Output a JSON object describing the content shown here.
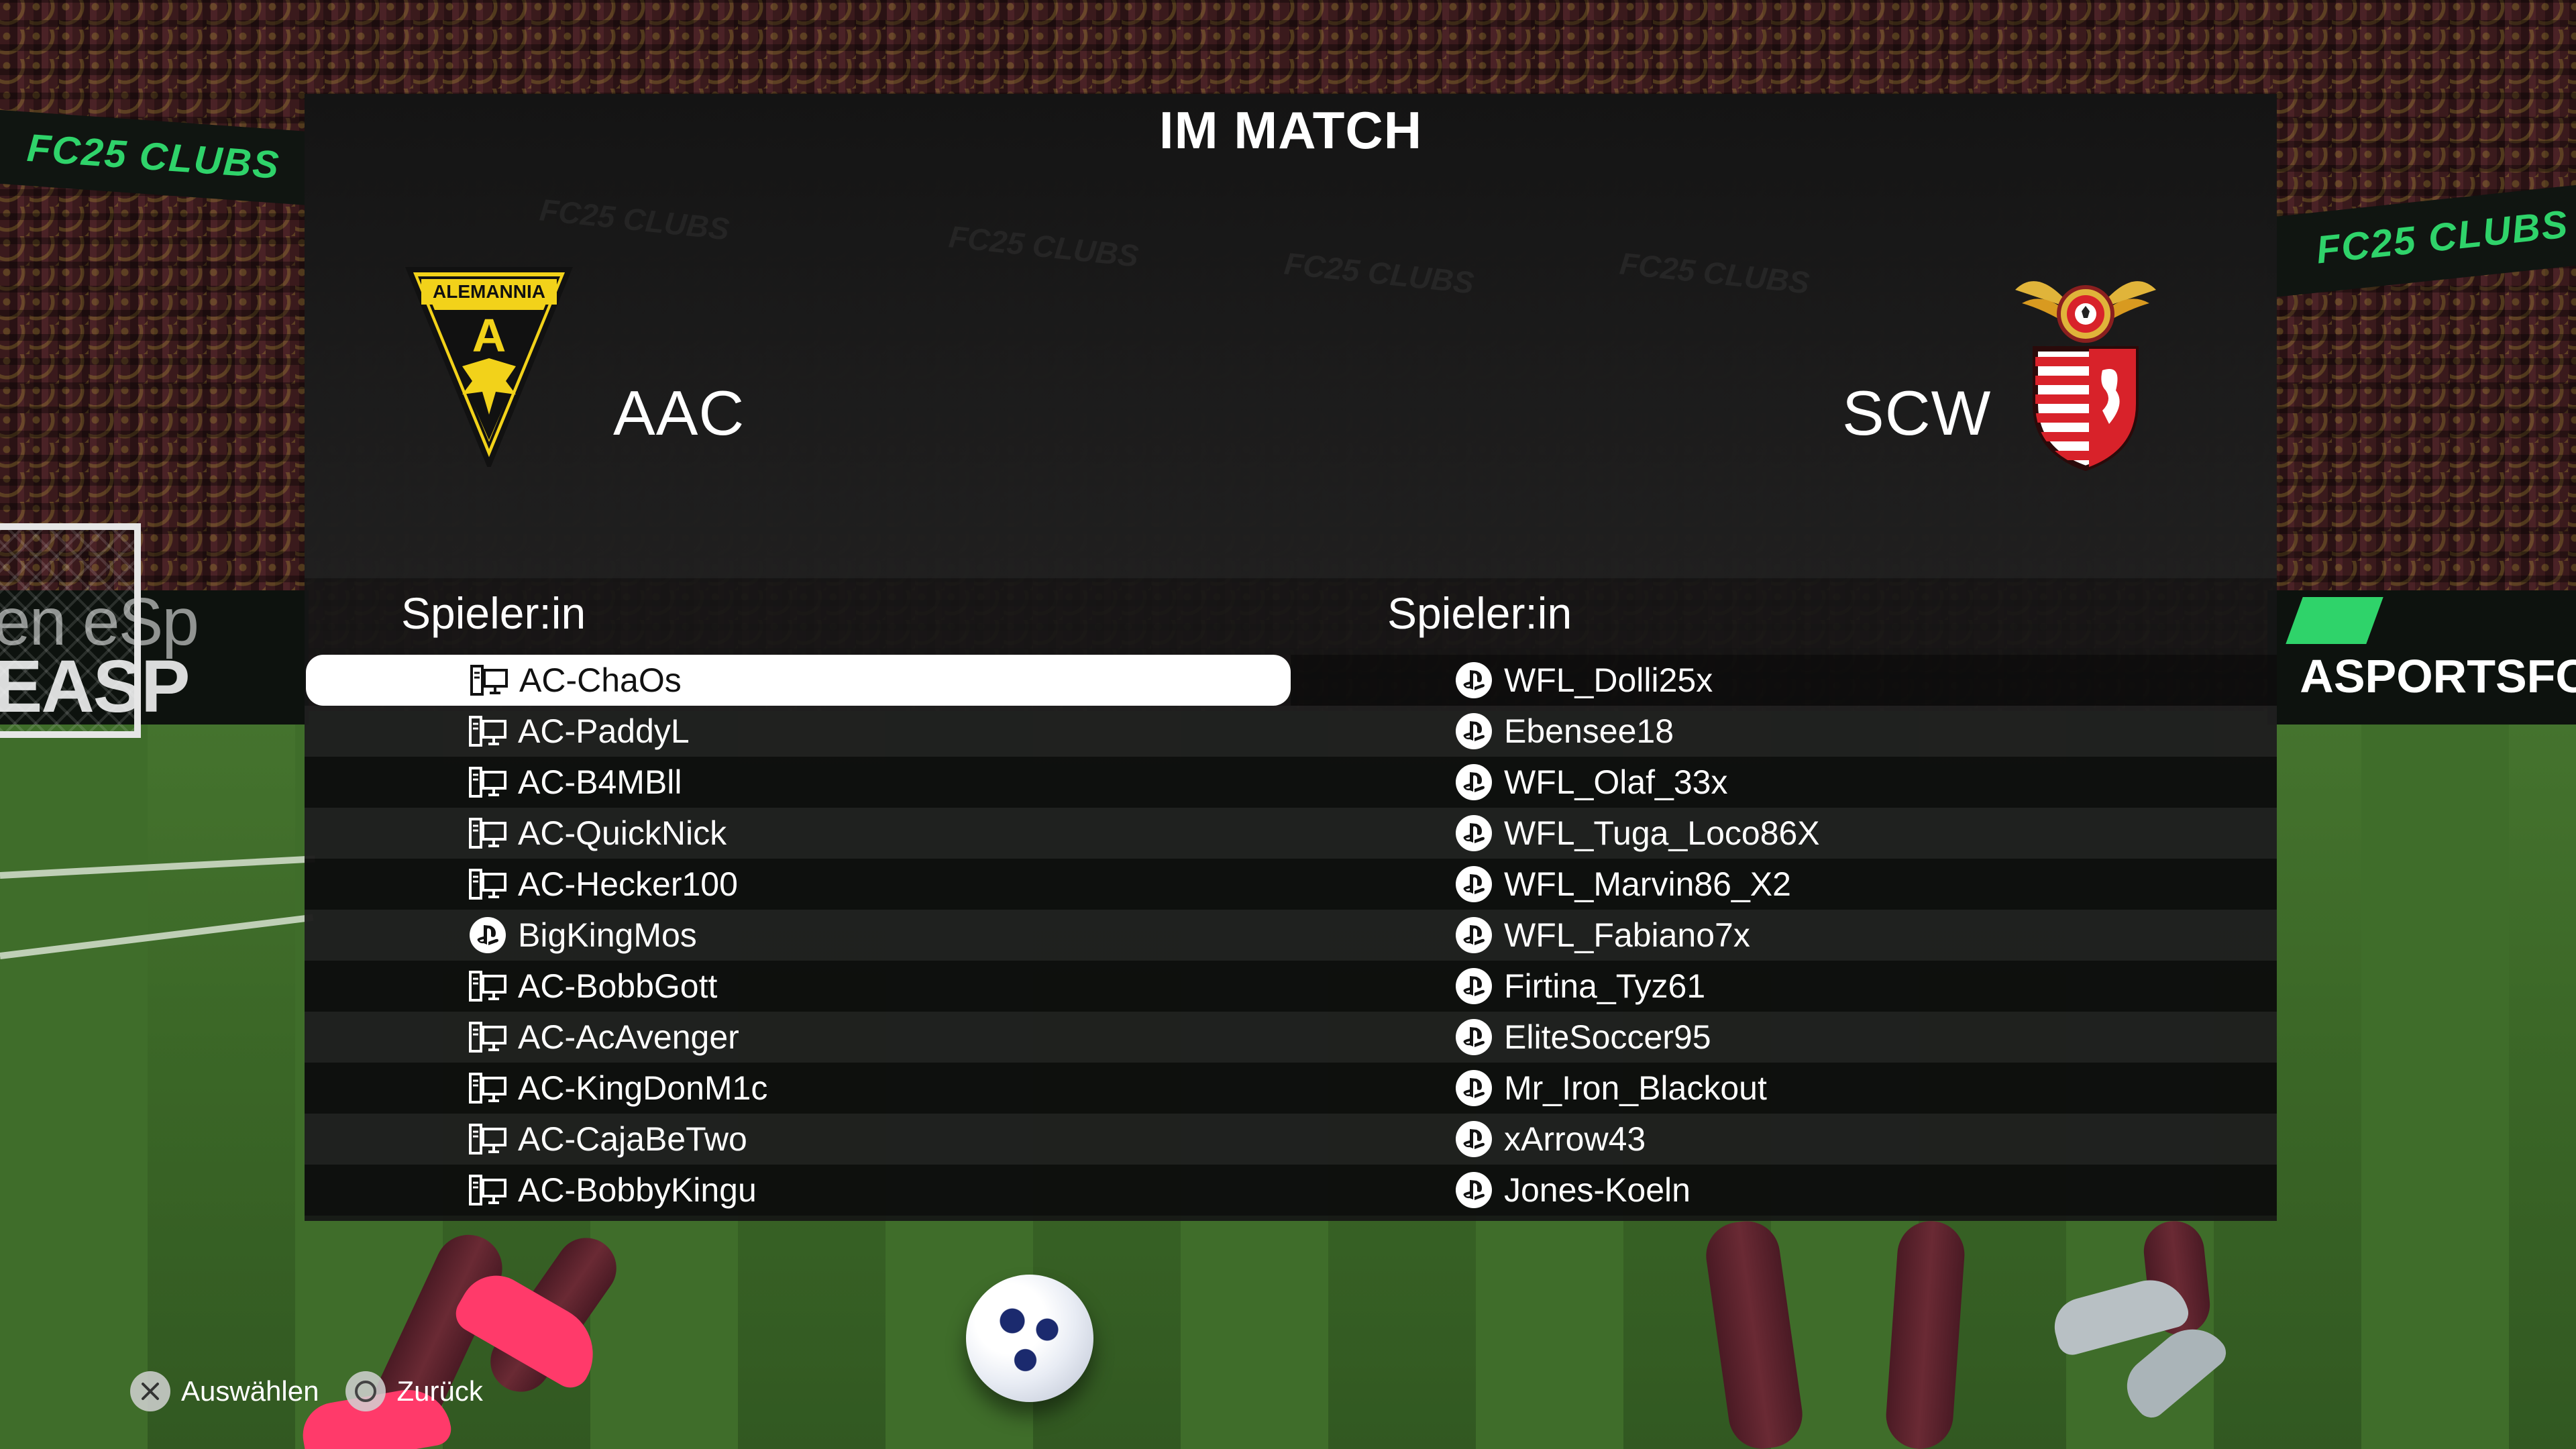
{
  "screen": {
    "title": "IM MATCH"
  },
  "background": {
    "board_left_text": "FC25 CLUBS",
    "board_right_text": "FC25 CLUBS",
    "header_watermark": "FC25 CLUBS",
    "ad_left_text": "en eSp",
    "ad_left_text2": "EASP",
    "ad_right_text": "ASPORTSFC"
  },
  "home_team": {
    "abbreviation": "AAC",
    "crest_text": "ALEMANNIA",
    "crest_letter": "A",
    "column_header": "Spieler:in",
    "players": [
      {
        "name": "AC-ChaOs",
        "platform": "pc",
        "selected": true
      },
      {
        "name": "AC-PaddyL",
        "platform": "pc",
        "selected": false
      },
      {
        "name": "AC-B4MBll",
        "platform": "pc",
        "selected": false
      },
      {
        "name": "AC-QuickNick",
        "platform": "pc",
        "selected": false
      },
      {
        "name": "AC-Hecker100",
        "platform": "pc",
        "selected": false
      },
      {
        "name": "BigKingMos",
        "platform": "playstation",
        "selected": false
      },
      {
        "name": "AC-BobbGott",
        "platform": "pc",
        "selected": false
      },
      {
        "name": "AC-AcAvenger",
        "platform": "pc",
        "selected": false
      },
      {
        "name": "AC-KingDonM1c",
        "platform": "pc",
        "selected": false
      },
      {
        "name": "AC-CajaBeTwo",
        "platform": "pc",
        "selected": false
      },
      {
        "name": "AC-BobbyKingu",
        "platform": "pc",
        "selected": false
      }
    ]
  },
  "away_team": {
    "abbreviation": "SCW",
    "column_header": "Spieler:in",
    "players": [
      {
        "name": "WFL_Dolli25x",
        "platform": "playstation"
      },
      {
        "name": "Ebensee18",
        "platform": "playstation"
      },
      {
        "name": "WFL_Olaf_33x",
        "platform": "playstation"
      },
      {
        "name": "WFL_Tuga_Loco86X",
        "platform": "playstation"
      },
      {
        "name": "WFL_Marvin86_X2",
        "platform": "playstation"
      },
      {
        "name": "WFL_Fabiano7x",
        "platform": "playstation"
      },
      {
        "name": "Firtina_Tyz61",
        "platform": "playstation"
      },
      {
        "name": "EliteSoccer95",
        "platform": "playstation"
      },
      {
        "name": "Mr_Iron_Blackout",
        "platform": "playstation"
      },
      {
        "name": "xArrow43",
        "platform": "playstation"
      },
      {
        "name": "Jones-Koeln",
        "platform": "playstation"
      }
    ]
  },
  "controls": {
    "select_label": "Auswählen",
    "select_icon": "cross-button-icon",
    "back_label": "Zurück",
    "back_icon": "circle-button-icon"
  },
  "colors": {
    "home_crest_yellow": "#f2d21a",
    "home_crest_black": "#111111",
    "away_crest_red": "#d8222a",
    "away_crest_gold": "#e0b43a",
    "selection_bg": "#ffffff"
  }
}
